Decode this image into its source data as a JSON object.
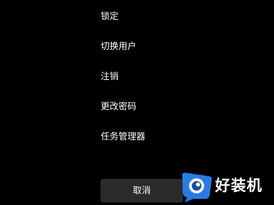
{
  "menu": {
    "items": [
      {
        "label": "锁定"
      },
      {
        "label": "切换用户"
      },
      {
        "label": "注销"
      },
      {
        "label": "更改密码"
      },
      {
        "label": "任务管理器"
      }
    ]
  },
  "cancel_button": {
    "label": "取消"
  },
  "watermark": {
    "text": "好装机",
    "logo_color": "#2b7be4",
    "icon": "watermark-logo-icon"
  }
}
